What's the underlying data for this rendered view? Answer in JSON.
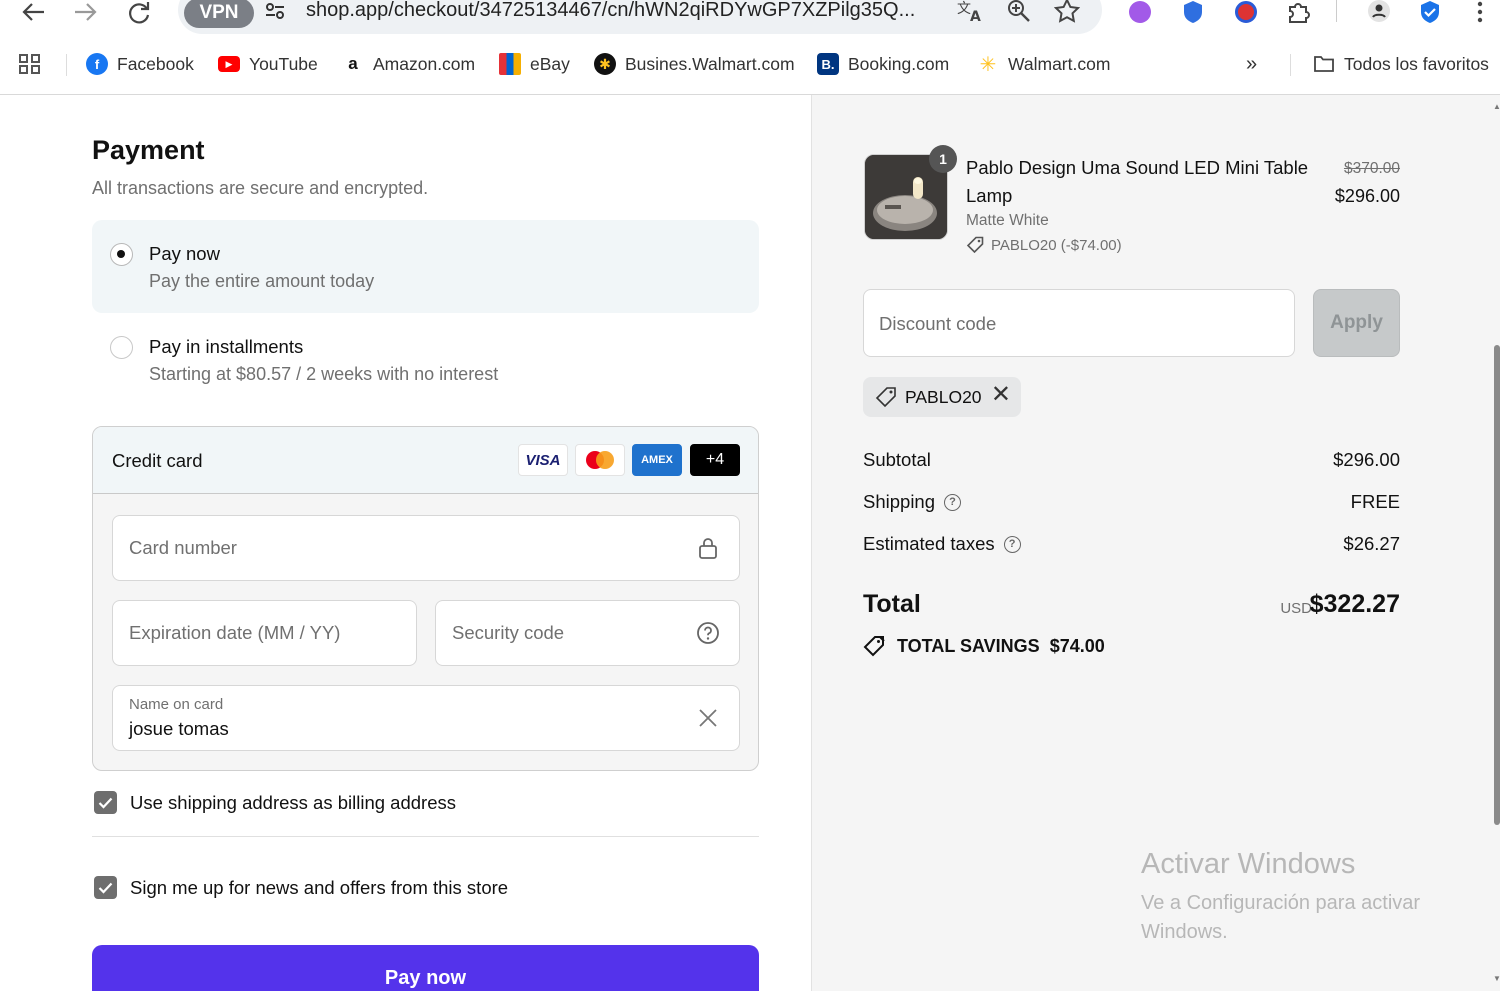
{
  "browser": {
    "vpn_label": "VPN",
    "url": "shop.app/checkout/34725134467/cn/hWN2qiRDYwGP7XZPilg35Q...",
    "bookmarks": [
      {
        "label": "Facebook",
        "icon": "facebook-icon",
        "color": "#1877f2"
      },
      {
        "label": "YouTube",
        "icon": "youtube-icon",
        "color": "#ff0000"
      },
      {
        "label": "Amazon.com",
        "icon": "amazon-icon",
        "color": "#111111"
      },
      {
        "label": "eBay",
        "icon": "ebay-icon",
        "color": "#e53238"
      },
      {
        "label": "Busines.Walmart.com",
        "icon": "walmart-business-icon",
        "color": "#111111"
      },
      {
        "label": "Booking.com",
        "icon": "booking-icon",
        "color": "#003580"
      },
      {
        "label": "Walmart.com",
        "icon": "walmart-spark-icon",
        "color": "#ffc220"
      }
    ],
    "all_bookmarks_label": "Todos los favoritos"
  },
  "payment": {
    "title": "Payment",
    "subtitle": "All transactions are secure and encrypted.",
    "options": [
      {
        "title": "Pay now",
        "subtitle": "Pay the entire amount today",
        "selected": true
      },
      {
        "title": "Pay in installments",
        "subtitle": "Starting at $80.57 / 2 weeks with no interest",
        "selected": false
      }
    ],
    "credit_card": {
      "title": "Credit card",
      "logos": [
        "VISA",
        "AMEX",
        "+4"
      ],
      "card_number_placeholder": "Card number",
      "expiration_placeholder": "Expiration date (MM / YY)",
      "security_placeholder": "Security code",
      "name_label": "Name on card",
      "name_value": "josue tomas"
    },
    "billing_checkbox": {
      "label": "Use shipping address as billing address",
      "checked": true
    },
    "news_checkbox": {
      "label": "Sign me up for news and offers from this store",
      "checked": true
    },
    "pay_button": "Pay now",
    "accent_color": "#5433eb"
  },
  "summary": {
    "product": {
      "quantity": "1",
      "name": "Pablo Design Uma Sound LED Mini Table Lamp",
      "variant": "Matte White",
      "discount": "PABLO20 (-$74.00)",
      "original_price": "$370.00",
      "price": "$296.00"
    },
    "discount_placeholder": "Discount code",
    "apply_button": "Apply",
    "applied_code": "PABLO20",
    "rows": [
      {
        "label": "Subtotal",
        "value": "$296.00"
      },
      {
        "label": "Shipping",
        "value": "FREE"
      },
      {
        "label": "Estimated taxes",
        "value": "$26.27"
      }
    ],
    "total_label": "Total",
    "currency": "USD",
    "total_value": "$322.27",
    "savings_label": "TOTAL SAVINGS",
    "savings_value": "$74.00"
  },
  "watermark": {
    "title": "Activar Windows",
    "subtitle": "Ve a Configuración para activar Windows."
  }
}
